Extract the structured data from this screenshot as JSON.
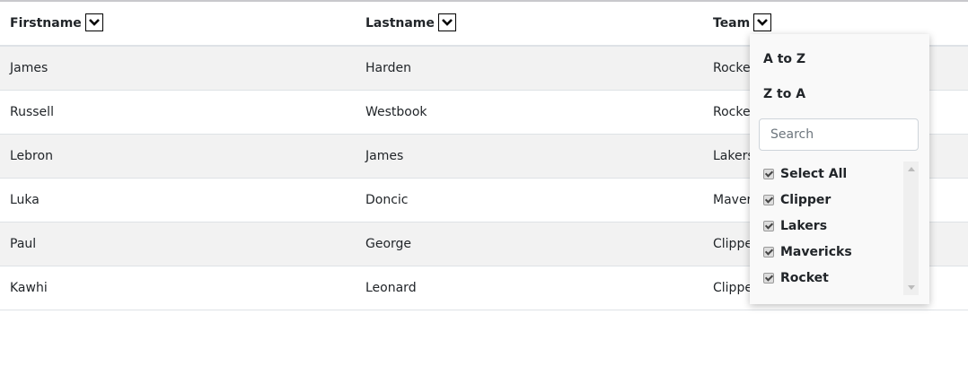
{
  "table": {
    "columns": [
      {
        "label": "Firstname"
      },
      {
        "label": "Lastname"
      },
      {
        "label": "Team"
      }
    ],
    "rows": [
      [
        "James",
        "Harden",
        "Rocket"
      ],
      [
        "Russell",
        "Westbook",
        "Rocket"
      ],
      [
        "Lebron",
        "James",
        "Lakers"
      ],
      [
        "Luka",
        "Doncic",
        "Mavericks"
      ],
      [
        "Paul",
        "George",
        "Clipper"
      ],
      [
        "Kawhi",
        "Leonard",
        "Clipper"
      ]
    ]
  },
  "filter_popup": {
    "sort_asc": "A to Z",
    "sort_desc": "Z to A",
    "search_placeholder": "Search",
    "options": [
      {
        "label": "Select All",
        "checked": true
      },
      {
        "label": "Clipper",
        "checked": true
      },
      {
        "label": "Lakers",
        "checked": true
      },
      {
        "label": "Mavericks",
        "checked": true
      },
      {
        "label": "Rocket",
        "checked": true
      }
    ]
  }
}
